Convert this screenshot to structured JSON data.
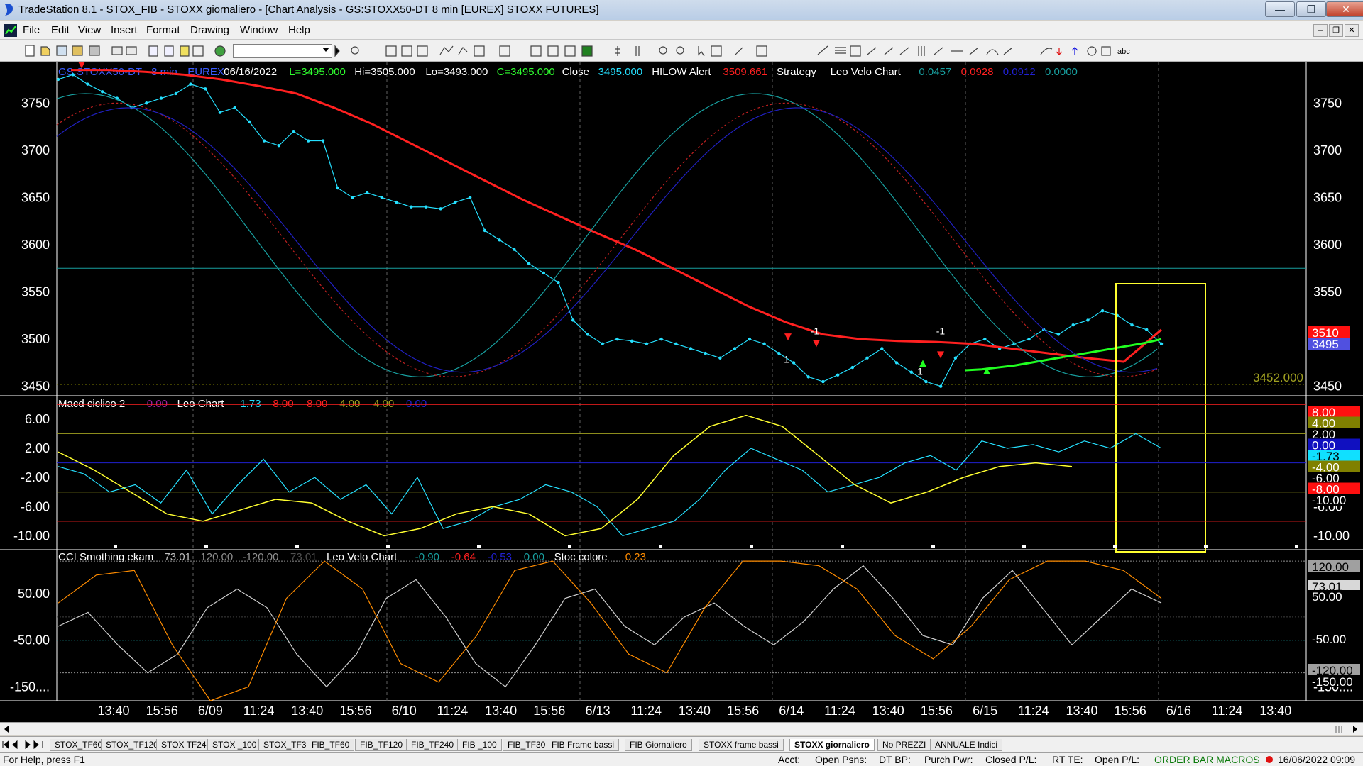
{
  "window": {
    "title": "TradeStation 8.1 - STOX_FIB - STOXX giornaliero - [Chart Analysis - GS:STOXX50-DT  8 min  [EUREX] STOXX FUTURES]",
    "minimize_icon": "minimize-icon",
    "maximize_icon": "maximize-icon",
    "close_icon": "close-icon"
  },
  "menu": [
    "File",
    "Edit",
    "View",
    "Insert",
    "Format",
    "Drawing",
    "Window",
    "Help"
  ],
  "price_panel": {
    "header": [
      {
        "text": "GS:STOXX50-DT - 8 min",
        "color": "#3a5bff"
      },
      {
        "text": "EUREX",
        "color": "#3a5bff"
      },
      {
        "text": "06/16/2022",
        "color": "#ffffff"
      },
      {
        "text": "L=3495.000",
        "color": "#2fff2f"
      },
      {
        "text": "Hi=3505.000",
        "color": "#ffffff"
      },
      {
        "text": "Lo=3493.000",
        "color": "#ffffff"
      },
      {
        "text": "C=3495.000",
        "color": "#2fff2f"
      },
      {
        "text": "Close",
        "color": "#ffffff"
      },
      {
        "text": "3495.000",
        "color": "#25e0ff"
      },
      {
        "text": "HILOW Alert",
        "color": "#ffffff"
      },
      {
        "text": "3509.661",
        "color": "#ff2020"
      },
      {
        "text": "Strategy",
        "color": "#ffffff"
      },
      {
        "text": "Leo Velo Chart",
        "color": "#ffffff"
      },
      {
        "text": "0.0457",
        "color": "#18a0a0"
      },
      {
        "text": "0.0928",
        "color": "#ff2020"
      },
      {
        "text": "0.0912",
        "color": "#2020d0"
      },
      {
        "text": "0.0000",
        "color": "#18a0a0"
      }
    ],
    "y_ticks": [
      "3750",
      "3700",
      "3650",
      "3600",
      "3550",
      "3500",
      "3450"
    ],
    "price_tags": [
      {
        "text": "3510",
        "bg": "#ff1010",
        "fg": "#ffffff"
      },
      {
        "text": "3495",
        "bg": "#5050e0",
        "fg": "#ffffff"
      }
    ],
    "level_label": "3452.000",
    "trade_labels": [
      "1",
      "-1",
      "1",
      "-1"
    ]
  },
  "macd_panel": {
    "header": [
      {
        "text": "Macd ciclico 2",
        "color": "#ffffff"
      },
      {
        "text": "0.00",
        "color": "#a020a0"
      },
      {
        "text": "Leo Chart",
        "color": "#ffffff"
      },
      {
        "text": "-1.73",
        "color": "#25e0ff"
      },
      {
        "text": "8.00",
        "color": "#ff2020"
      },
      {
        "text": "-8.00",
        "color": "#ff2020"
      },
      {
        "text": "4.00",
        "color": "#a0a020"
      },
      {
        "text": "-4.00",
        "color": "#a0a020"
      },
      {
        "text": "0.00",
        "color": "#2020d0"
      }
    ],
    "y_ticks": [
      "6.00",
      "2.00",
      "-2.00",
      "-6.00",
      "-10.00"
    ],
    "tags": [
      {
        "text": "8.00",
        "bg": "#ff1010",
        "fg": "#ffffff"
      },
      {
        "text": "4.00",
        "bg": "#808000",
        "fg": "#ffffff"
      },
      {
        "text": "2.00",
        "bg": "#000000",
        "fg": "#ffffff"
      },
      {
        "text": "0.00",
        "bg": "#1010c0",
        "fg": "#ffffff"
      },
      {
        "text": "-1.73",
        "bg": "#10e0ff",
        "fg": "#000000"
      },
      {
        "text": "-4.00",
        "bg": "#808000",
        "fg": "#ffffff"
      },
      {
        "text": "-6.00",
        "bg": "#000000",
        "fg": "#ffffff"
      },
      {
        "text": "-8.00",
        "bg": "#ff1010",
        "fg": "#ffffff"
      },
      {
        "text": "-10.00",
        "bg": "#000000",
        "fg": "#ffffff"
      }
    ]
  },
  "cci_panel": {
    "header": [
      {
        "text": "CCI Smothing ekam",
        "color": "#ffffff"
      },
      {
        "text": "73.01",
        "color": "#c0c0c0"
      },
      {
        "text": "120.00",
        "color": "#909090"
      },
      {
        "text": "-120.00",
        "color": "#909090"
      },
      {
        "text": "73.01",
        "color": "#505050"
      },
      {
        "text": "Leo Velo Chart",
        "color": "#ffffff"
      },
      {
        "text": "-0.90",
        "color": "#18a0a0"
      },
      {
        "text": "-0.64",
        "color": "#ff2020"
      },
      {
        "text": "-0.53",
        "color": "#2020d0"
      },
      {
        "text": "0.00",
        "color": "#18a0a0"
      },
      {
        "text": "Stoc colore",
        "color": "#ffffff"
      },
      {
        "text": "0.23",
        "color": "#ff8c00"
      }
    ],
    "y_ticks": [
      "50.00",
      "-50.00",
      "-150...."
    ],
    "tags": [
      {
        "text": "120.00",
        "bg": "#a0a0a0",
        "fg": "#000000"
      },
      {
        "text": "73.01",
        "bg": "#d8d8d8",
        "fg": "#000000"
      },
      {
        "text": "50.00",
        "bg": "#000000",
        "fg": "#ffffff"
      },
      {
        "text": "-50.00",
        "bg": "#000000",
        "fg": "#ffffff"
      },
      {
        "text": "-120.00",
        "bg": "#a0a0a0",
        "fg": "#000000"
      },
      {
        "text": "-150.00",
        "bg": "#000000",
        "fg": "#ffffff"
      }
    ]
  },
  "x_axis_ticks": [
    "13:40",
    "15:56",
    "6/09",
    "11:24",
    "13:40",
    "15:56",
    "6/10",
    "11:24",
    "13:40",
    "15:56",
    "6/13",
    "11:24",
    "13:40",
    "15:56",
    "6/14",
    "11:24",
    "13:40",
    "15:56",
    "6/15",
    "11:24",
    "13:40",
    "15:56",
    "6/16",
    "11:24",
    "13:40"
  ],
  "chart_data": {
    "type": "line",
    "title": "GS:STOXX50-DT - 8 min",
    "ylim": [
      3440,
      3790
    ],
    "series": [
      {
        "name": "Close",
        "color": "#25e0ff",
        "values": [
          3775,
          3780,
          3770,
          3762,
          3755,
          3745,
          3750,
          3755,
          3760,
          3770,
          3765,
          3740,
          3745,
          3730,
          3710,
          3705,
          3720,
          3710,
          3710,
          3660,
          3650,
          3655,
          3650,
          3645,
          3640,
          3640,
          3638,
          3645,
          3650,
          3615,
          3605,
          3595,
          3580,
          3570,
          3560,
          3520,
          3505,
          3495,
          3500,
          3498,
          3495,
          3500,
          3495,
          3490,
          3485,
          3480,
          3490,
          3500,
          3495,
          3485,
          3475,
          3460,
          3455,
          3462,
          3470,
          3480,
          3490,
          3475,
          3465,
          3455,
          3450,
          3480,
          3495,
          3500,
          3490,
          3495,
          3500,
          3510,
          3505,
          3515,
          3520,
          3530,
          3525,
          3515,
          3510,
          3495
        ]
      },
      {
        "name": "HILOW Alert",
        "color": "#ff2020",
        "values": [
          3785,
          3785,
          3783,
          3780,
          3775,
          3768,
          3760,
          3745,
          3728,
          3708,
          3688,
          3668,
          3648,
          3630,
          3612,
          3595,
          3575,
          3555,
          3535,
          3518,
          3505,
          3500,
          3498,
          3497,
          3495,
          3490,
          3485,
          3480,
          3476,
          3510
        ]
      },
      {
        "name": "Strategy stop",
        "color": "#20ff20",
        "values": [
          3467,
          3468,
          3470,
          3472,
          3475,
          3478,
          3481,
          3484,
          3487,
          3490,
          3493,
          3496,
          3500
        ]
      }
    ],
    "horizontal_lines": [
      {
        "name": "level-3575",
        "value": 3575,
        "color": "#18a0a0"
      },
      {
        "name": "level-3452",
        "value": 3452,
        "color": "#808000",
        "label": "3452.000"
      }
    ],
    "macd": {
      "ylim": [
        -12,
        9
      ],
      "levels": [
        8,
        4,
        0,
        -4,
        -8
      ],
      "series": [
        {
          "name": "Leo Chart",
          "color": "#25e0ff",
          "values": [
            -0.5,
            -1.5,
            -4.0,
            -3.0,
            -5.5,
            -1.0,
            -7.0,
            -3.0,
            0.5,
            -4.0,
            -2.0,
            -5.0,
            -3.0,
            -7.0,
            -2.0,
            -9.0,
            -8.0,
            -6.0,
            -5.0,
            -3.0,
            -4.0,
            -6.0,
            -10.0,
            -9.0,
            -8.0,
            -5.0,
            -1.0,
            2.0,
            0.5,
            -1.0,
            -4.0,
            -3.0,
            -2.0,
            0.0,
            1.0,
            -1.0,
            3.0,
            2.0,
            2.5,
            1.5,
            3.0,
            2.0,
            4.0,
            2.0
          ]
        },
        {
          "name": "Macd slow",
          "color": "#ffff30",
          "values": [
            1.5,
            -1.0,
            -4.0,
            -7.0,
            -8.0,
            -6.5,
            -5.0,
            -5.5,
            -8.0,
            -10.0,
            -9.0,
            -7.0,
            -6.0,
            -7.0,
            -10.0,
            -9.0,
            -5.0,
            1.0,
            5.0,
            6.5,
            5.0,
            1.0,
            -3.0,
            -5.5,
            -4.0,
            -2.0,
            -0.5,
            0.0,
            -0.5
          ]
        }
      ]
    },
    "cci": {
      "ylim": [
        -180,
        140
      ],
      "levels": [
        120,
        0,
        -50,
        -120
      ],
      "series": [
        {
          "name": "CCI Smothing ekam",
          "color": "#d0d0d0",
          "values": [
            -20,
            10,
            -60,
            -120,
            -80,
            20,
            60,
            20,
            -80,
            -150,
            -80,
            40,
            80,
            0,
            -100,
            -150,
            -60,
            40,
            60,
            -20,
            -60,
            0,
            30,
            -20,
            -60,
            -10,
            60,
            110,
            40,
            -40,
            -60,
            40,
            100,
            20,
            -60,
            0,
            60,
            30
          ]
        },
        {
          "name": "Stoc colore",
          "color": "#ff8c00",
          "values": [
            30,
            90,
            100,
            -60,
            -180,
            -150,
            40,
            120,
            60,
            -100,
            -140,
            -40,
            100,
            120,
            30,
            -80,
            -120,
            20,
            120,
            120,
            110,
            60,
            -40,
            -90,
            -20,
            80,
            120,
            120,
            100,
            40
          ]
        }
      ]
    }
  },
  "tabs": [
    "STOX_TF60",
    "STOX_TF120",
    "STOX TF240",
    "STOX _100",
    "STOX_TF30",
    "FIB_TF60",
    "FIB_TF120",
    "FIB_TF240",
    "FIB _100",
    "FIB_TF30",
    "FIB Frame bassi",
    "FIB Giornaliero",
    "STOXX frame bassi",
    "STOXX giornaliero",
    "No PREZZI",
    "ANNUALE Indici"
  ],
  "active_tab": "STOXX giornaliero",
  "status": {
    "help": "For Help, press F1",
    "acct": "Acct:",
    "open_psns": "Open Psns:",
    "dt_bp": "DT BP:",
    "purch_pwr": "Purch Pwr:",
    "closed_pl": "Closed P/L:",
    "rt_te": "RT TE:",
    "open_pl": "Open P/L:",
    "macros": "ORDER BAR  MACROS",
    "datetime": "16/06/2022 09:09"
  },
  "colors": {
    "chart_bg": "#000000",
    "price_line": "#25e0ff",
    "hilow": "#ff2020",
    "strategy": "#20ff20",
    "highlight_box": "#ffff30"
  }
}
